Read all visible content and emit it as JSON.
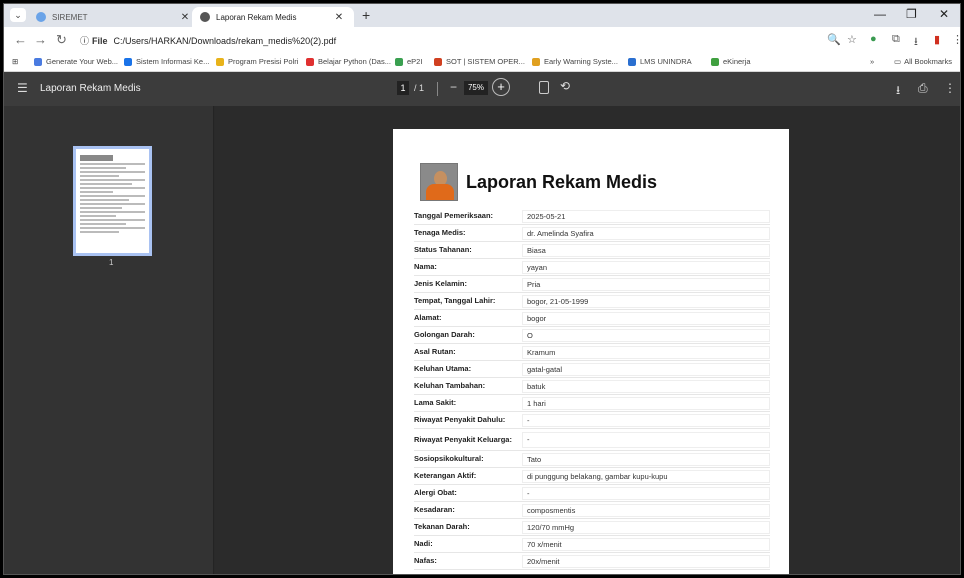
{
  "browser": {
    "tabs": [
      {
        "title": "SIREMET",
        "active": false,
        "favicon_color": "#6aa3e8"
      },
      {
        "title": "Laporan Rekam Medis",
        "active": true,
        "favicon_color": "#555555"
      }
    ],
    "address": {
      "chip": "File",
      "url": "C:/Users/HARKAN/Downloads/rekam_medis%20(2).pdf"
    },
    "bookmarks": [
      {
        "label": "Generate Your Web...",
        "color": "#4a7be0"
      },
      {
        "label": "Sistem Informasi Ke...",
        "color": "#1a73e8"
      },
      {
        "label": "Program Presisi Polri",
        "color": "#e8b31a"
      },
      {
        "label": "Belajar Python (Das...",
        "color": "#e03030"
      },
      {
        "label": "eP2I",
        "color": "#3aa050"
      },
      {
        "label": "SOT | SISTEM OPER...",
        "color": "#d04020"
      },
      {
        "label": "Early Warning Syste...",
        "color": "#e0a020"
      },
      {
        "label": "LMS UNINDRA",
        "color": "#2a6fd0"
      },
      {
        "label": "eKinerja",
        "color": "#40a040"
      }
    ],
    "all_bookmarks_label": "All Bookmarks"
  },
  "pdf_viewer": {
    "title": "Laporan Rekam Medis",
    "current_page": "1",
    "total_pages": "/ 1",
    "zoom": "75%",
    "thumbnail_page_number": "1"
  },
  "report": {
    "title": "Laporan Rekam Medis",
    "fields": [
      {
        "label": "Tanggal Pemeriksaan:",
        "value": "2025-05-21"
      },
      {
        "label": "Tenaga Medis:",
        "value": "dr. Amelinda Syafira"
      },
      {
        "label": "Status Tahanan:",
        "value": "Biasa"
      },
      {
        "label": "Nama:",
        "value": "yayan"
      },
      {
        "label": "Jenis Kelamin:",
        "value": "Pria"
      },
      {
        "label": "Tempat, Tanggal Lahir:",
        "value": "bogor, 21-05-1999"
      },
      {
        "label": "Alamat:",
        "value": "bogor"
      },
      {
        "label": "Golongan Darah:",
        "value": "O"
      },
      {
        "label": "Asal Rutan:",
        "value": "Kramum"
      },
      {
        "label": "Keluhan Utama:",
        "value": "gatal-gatal"
      },
      {
        "label": "Keluhan Tambahan:",
        "value": "batuk"
      },
      {
        "label": "Lama Sakit:",
        "value": "1 hari"
      },
      {
        "label": "Riwayat Penyakit Dahulu:",
        "value": "-"
      },
      {
        "label": "Riwayat Penyakit Keluarga:",
        "value": "-"
      },
      {
        "label": "Sosiopsikokultural:",
        "value": "Tato"
      },
      {
        "label": "Keterangan Aktif:",
        "value": "di punggung belakang, gambar kupu-kupu"
      },
      {
        "label": "Alergi Obat:",
        "value": "-"
      },
      {
        "label": "Kesadaran:",
        "value": "composmentis"
      },
      {
        "label": "Tekanan Darah:",
        "value": "120/70 mmHg"
      },
      {
        "label": "Nadi:",
        "value": "70 x/menit"
      },
      {
        "label": "Nafas:",
        "value": "20x/menit"
      }
    ]
  }
}
